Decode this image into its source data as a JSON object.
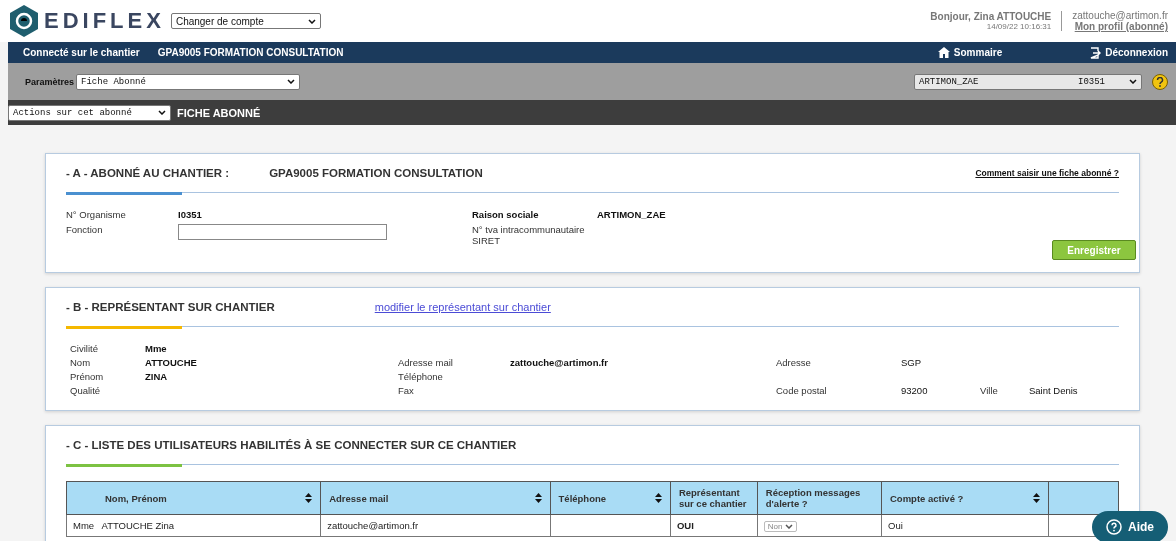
{
  "header": {
    "logo_text": "EDIFLEX",
    "account_select": "Changer de compte",
    "greeting": "Bonjour, Zina ATTOUCHE",
    "datetime": "14/09/22 10:16:31",
    "email": "zattouche@artimon.fr",
    "profile_link": "Mon profil (abonné)"
  },
  "nav": {
    "label": "Connecté sur le chantier",
    "chantier": "GPA9005 FORMATION CONSULTATION",
    "links": [
      {
        "kind": "home",
        "label": "Sommaire"
      },
      {
        "kind": "logout",
        "label": "Déconnexion"
      }
    ]
  },
  "params": {
    "label": "Paramètres",
    "select": "Fiche Abonné",
    "subscriber_name": "ARTIMON_ZAE",
    "subscriber_code": "I0351"
  },
  "actions": {
    "select": "Actions sur cet abonné",
    "title": "FICHE ABONNÉ"
  },
  "section_a": {
    "title": "- A - ABONNÉ AU CHANTIER :",
    "chantier": "GPA9005 FORMATION CONSULTATION",
    "help_link": "Comment saisir une fiche abonné ?",
    "org_label": "N° Organisme",
    "org_value": "I0351",
    "fonction_label": "Fonction",
    "raison_label": "Raison sociale",
    "raison_value": "ARTIMON_ZAE",
    "tva_label": "N° tva intracommunautaire",
    "siret_label": "SIRET",
    "save_button": "Enregistrer"
  },
  "section_b": {
    "title": "- B - REPRÉSENTANT SUR CHANTIER",
    "link": "modifier le représentant sur chantier",
    "rows": [
      [
        {
          "label": "Civilité",
          "value": "Mme"
        },
        null,
        null,
        null
      ],
      [
        {
          "label": "Nom",
          "value": "ATTOUCHE"
        },
        {
          "label": "Adresse mail",
          "value": "zattouche@artimon.fr"
        },
        {
          "label": "Adresse",
          "value": "SGP"
        },
        null
      ],
      [
        {
          "label": "Prénom",
          "value": "ZINA"
        },
        {
          "label": "Téléphone"
        },
        null,
        null
      ],
      [
        {
          "label": "Qualité"
        },
        {
          "label": "Fax"
        },
        {
          "label": "Code postal",
          "value": "93200"
        },
        {
          "label": "Ville",
          "value": "Saint Denis"
        }
      ]
    ]
  },
  "section_c": {
    "title": "- C - LISTE DES UTILISATEURS HABILITÉS À SE CONNECTER SUR CE CHANTIER",
    "columns": [
      {
        "label": "Nom, Prénom",
        "sortable": true
      },
      {
        "label": "Adresse mail",
        "sortable": true
      },
      {
        "label": "Téléphone",
        "sortable": true
      },
      {
        "label": "Représentant sur ce chantier",
        "sortable": false
      },
      {
        "label": "Réception messages d'alerte ?",
        "sortable": false
      },
      {
        "label": "Compte activé ?",
        "sortable": true
      }
    ],
    "rows": [
      {
        "civilite": "Mme",
        "name": "ATTOUCHE Zina",
        "email": "zattouche@artimon.fr",
        "representative": "OUI",
        "alerts": "Non",
        "active": "Oui"
      }
    ]
  },
  "help_button": "Aide"
}
